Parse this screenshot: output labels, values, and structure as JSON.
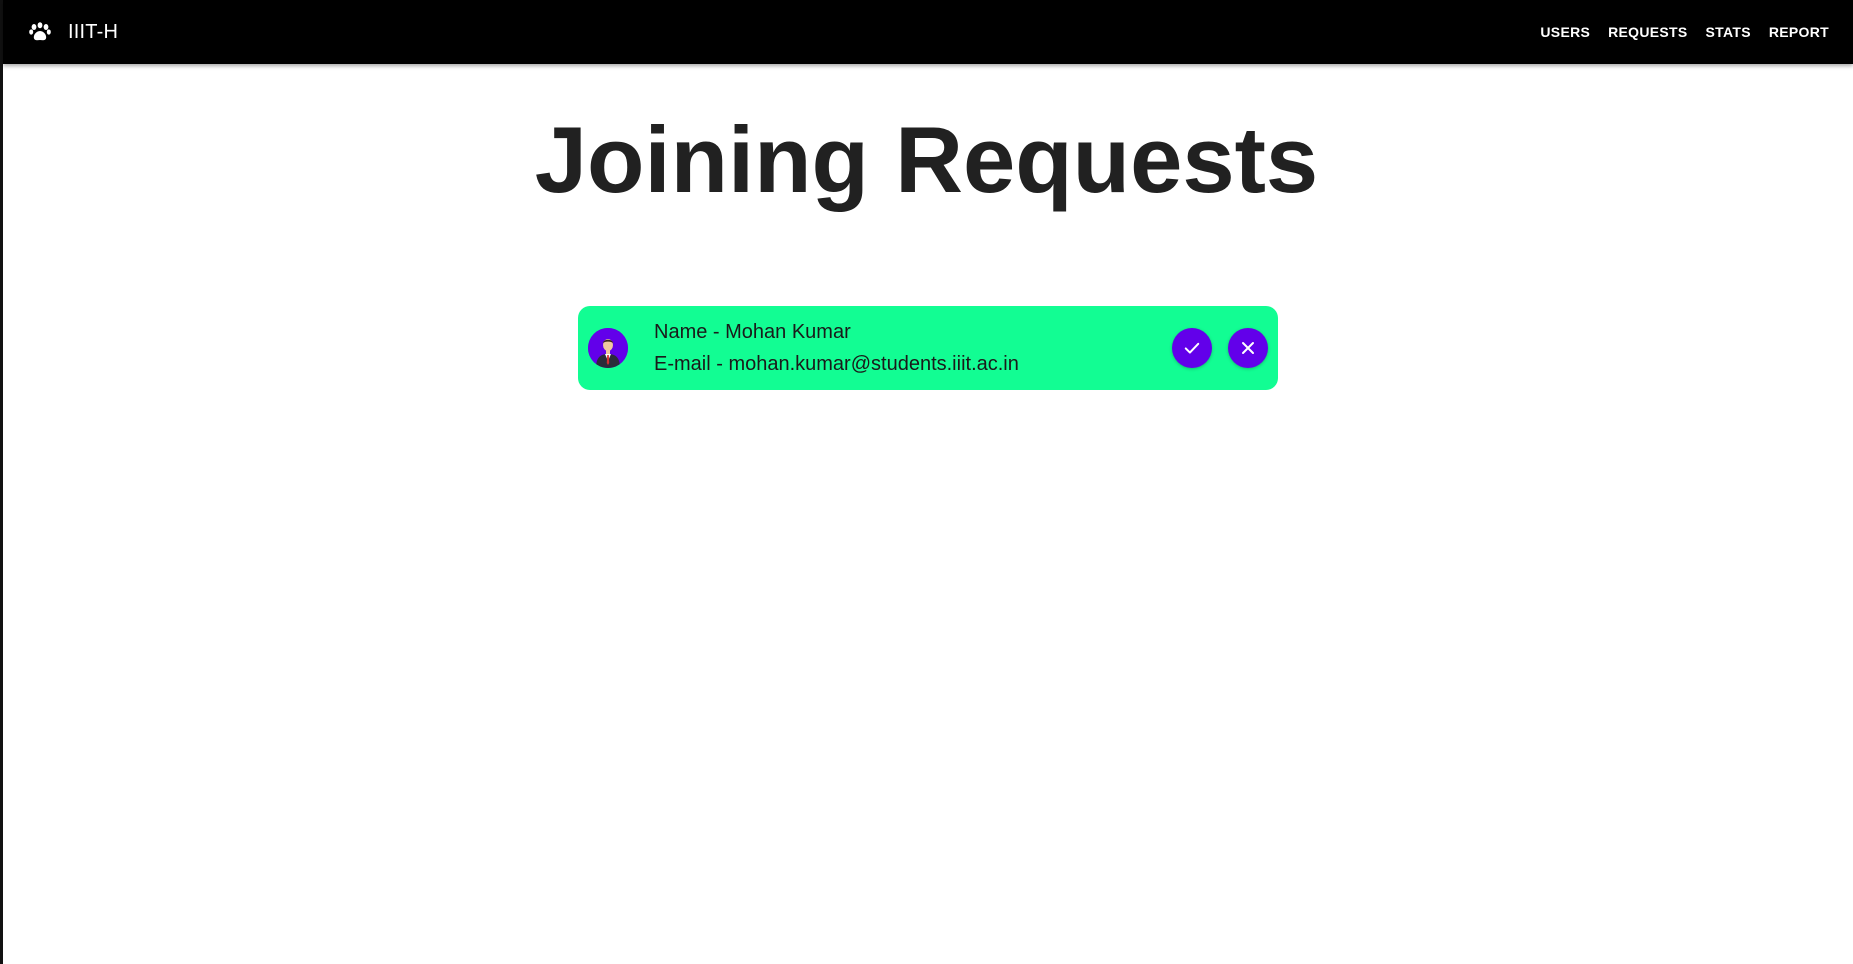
{
  "appbar": {
    "brand_icon": "paw-icon",
    "title": "IIIT-H",
    "nav": [
      {
        "label": "USERS"
      },
      {
        "label": "REQUESTS"
      },
      {
        "label": "STATS"
      },
      {
        "label": "REPORT"
      }
    ]
  },
  "page": {
    "title": "Joining Requests"
  },
  "requests": [
    {
      "avatar_icon": "user-avatar-icon",
      "name_line": "Name - Mohan Kumar",
      "email_line": "E-mail - mohan.kumar@students.iiit.ac.in",
      "accept_icon": "check-icon",
      "reject_icon": "close-icon"
    }
  ],
  "colors": {
    "appbar_bg": "#000000",
    "card_bg": "#12fd93",
    "accent": "#6200ea",
    "title_text": "#212121"
  }
}
